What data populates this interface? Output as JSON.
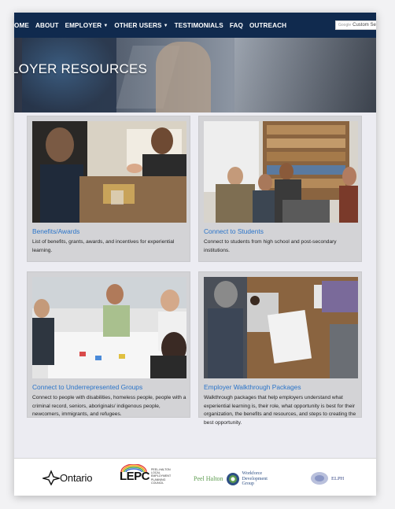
{
  "nav": {
    "items": [
      {
        "label": "OME",
        "dropdown": false
      },
      {
        "label": "ABOUT",
        "dropdown": false
      },
      {
        "label": "EMPLOYER",
        "dropdown": true
      },
      {
        "label": "OTHER USERS",
        "dropdown": true
      },
      {
        "label": "TESTIMONIALS",
        "dropdown": false
      },
      {
        "label": "FAQ",
        "dropdown": false
      },
      {
        "label": "OUTREACH",
        "dropdown": false
      }
    ],
    "search_brand": "Google",
    "search_placeholder": "Custom Se"
  },
  "hero": {
    "title": "LOYER RESOURCES"
  },
  "cards": [
    {
      "title": "Benefits/Awards",
      "description": "List of benefits, grants, awards, and incentives for experiential learning."
    },
    {
      "title": "Connect to Students",
      "description": "Connect to students from high school and post-secondary institutions."
    },
    {
      "title": "Connect to Underrepresented Groups",
      "description": "Connect to people with disabilities, homeless people, people with a criminal record, seniors, aboriginals/ indigenous people, newcomers, immigrants, and refugees."
    },
    {
      "title": "Employer Walkthrough Packages",
      "description": "Walkthrough packages that help employers understand what experiential learning is, their role, what opportunity is best for their organization, the benefits and resources, and steps to creating the best opportunity."
    }
  ],
  "footer": {
    "ontario": "Ontario",
    "lepc": "LEPC",
    "lepc_sub": "PEEL-HALTON LOCAL EMPLOYMENT PLANNING COUNCIL",
    "peel_halton": "Peel Halton",
    "wdg": "Workforce Development Group",
    "elph": "ELPH"
  },
  "colors": {
    "navbar": "#102a4e",
    "link": "#2a74c9",
    "card_bg": "#d3d3d6",
    "page_bg": "#ececf2"
  }
}
